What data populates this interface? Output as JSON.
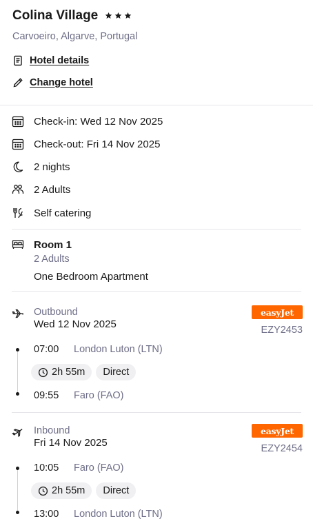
{
  "hotel": {
    "name": "Colina Village",
    "stars": 3,
    "location": "Carvoeiro, Algarve, Portugal",
    "details_link": "Hotel details",
    "change_link": "Change hotel"
  },
  "stay": {
    "check_in": "Check-in: Wed 12 Nov 2025",
    "check_out": "Check-out: Fri 14 Nov 2025",
    "nights": "2 nights",
    "guests": "2 Adults",
    "board": "Self catering"
  },
  "room": {
    "title": "Room 1",
    "occupancy": "2 Adults",
    "type": "One Bedroom Apartment"
  },
  "outbound": {
    "direction": "Outbound",
    "date": "Wed 12 Nov 2025",
    "airline": "easyJet",
    "airline_color": "#ff6600",
    "flight_number": "EZY2453",
    "depart_time": "07:00",
    "depart_place": "London Luton (LTN)",
    "duration": "2h 55m",
    "stops": "Direct",
    "arrive_time": "09:55",
    "arrive_place": "Faro (FAO)"
  },
  "inbound": {
    "direction": "Inbound",
    "date": "Fri 14 Nov 2025",
    "airline": "easyJet",
    "airline_color": "#ff6600",
    "flight_number": "EZY2454",
    "depart_time": "10:05",
    "depart_place": "Faro (FAO)",
    "duration": "2h 55m",
    "stops": "Direct",
    "arrive_time": "13:00",
    "arrive_place": "London Luton (LTN)"
  },
  "icons": {
    "star": "star-icon",
    "details": "document-icon",
    "change": "pencil-icon",
    "calendar": "calendar-icon",
    "nights": "moon-icon",
    "guests": "people-icon",
    "board": "cutlery-icon",
    "room": "bed-icon",
    "outbound": "plane-departure-icon",
    "inbound": "plane-arrival-icon",
    "duration": "clock-icon"
  },
  "colors": {
    "text": "#1a1a1a",
    "muted": "#6e6e88",
    "divider": "#e6e6ea",
    "chip_bg": "#f0f0f3"
  }
}
